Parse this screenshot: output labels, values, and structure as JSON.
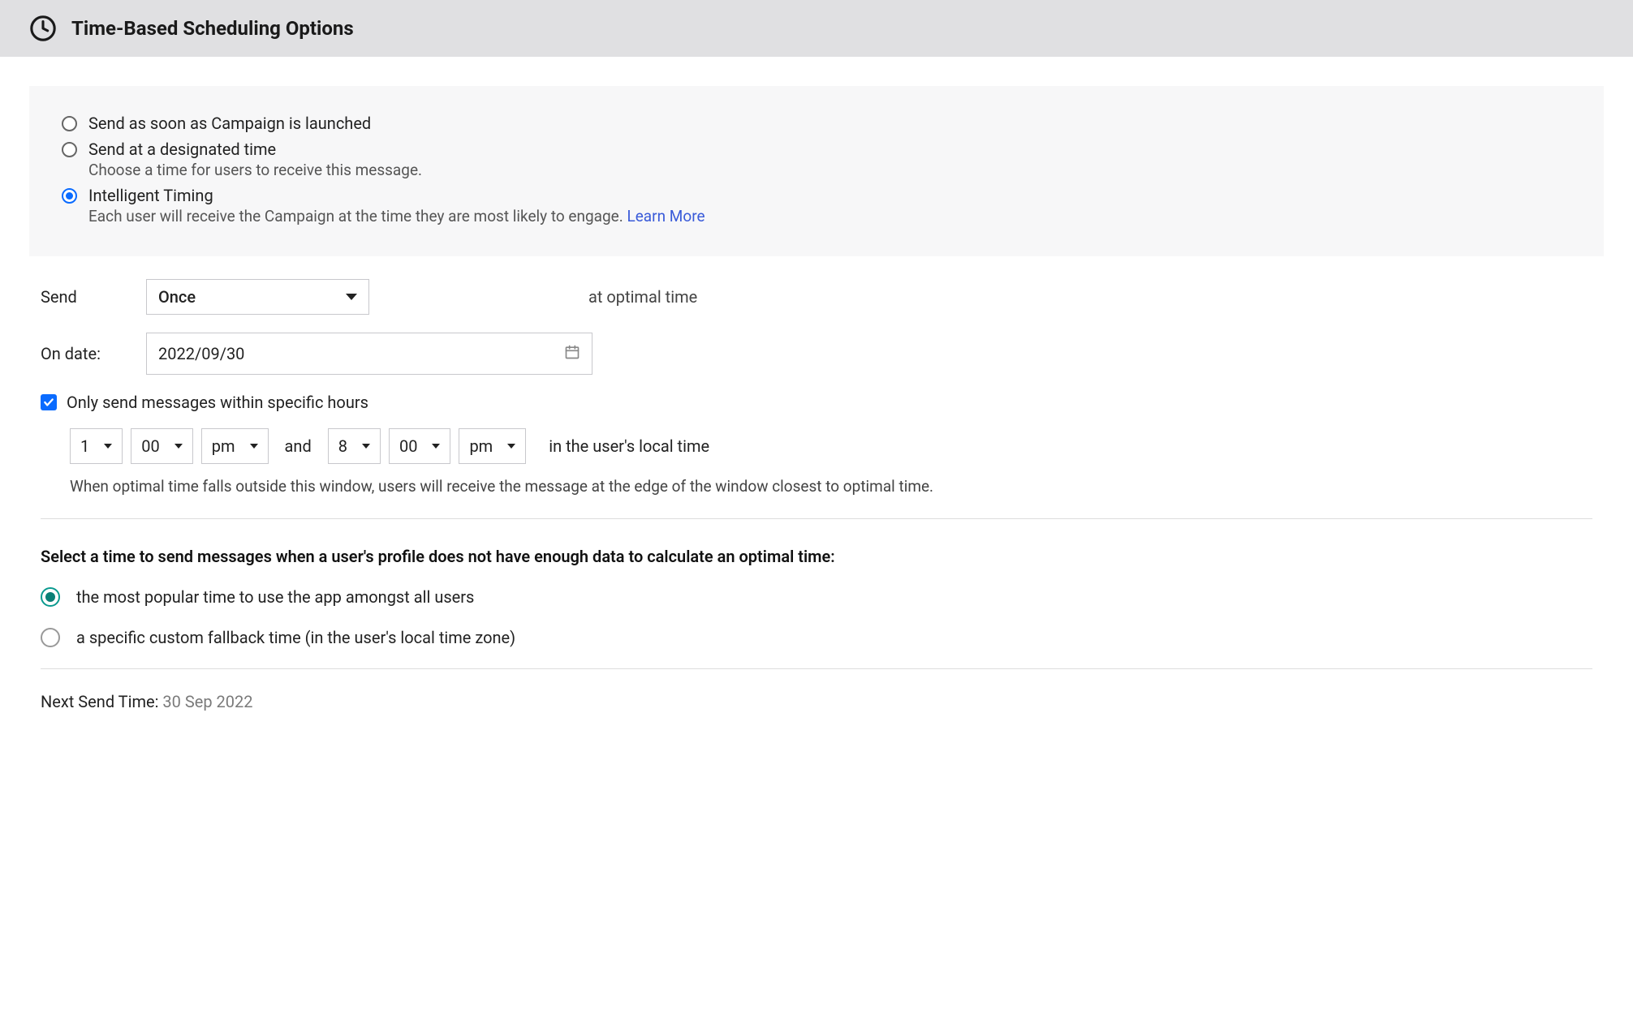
{
  "header": {
    "title": "Time-Based Scheduling Options"
  },
  "timing_options": {
    "immediate": {
      "label": "Send as soon as Campaign is launched"
    },
    "designated": {
      "label": "Send at a designated time",
      "sub": "Choose a time for users to receive this message."
    },
    "intelligent": {
      "label": "Intelligent Timing",
      "sub": "Each user will receive the Campaign at the time they are most likely to engage. ",
      "learn_more": "Learn More"
    }
  },
  "send": {
    "label": "Send",
    "frequency": "Once",
    "suffix": "at optimal time"
  },
  "on_date": {
    "label": "On date:",
    "value": "2022/09/30"
  },
  "specific_hours": {
    "checkbox_label": "Only send messages within specific hours",
    "from_hour": "1",
    "from_min": "00",
    "from_ampm": "pm",
    "connector": "and",
    "to_hour": "8",
    "to_min": "00",
    "to_ampm": "pm",
    "after_text": "in the user's local time",
    "note": "When optimal time falls outside this window, users will receive the message at the edge of the window closest to optimal time."
  },
  "fallback": {
    "heading": "Select a time to send messages when a user's profile does not have enough data to calculate an optimal time:",
    "popular": "the most popular time to use the app amongst all users",
    "custom": "a specific custom fallback time (in the user's local time zone)"
  },
  "next_send": {
    "label": "Next Send Time: ",
    "value": "30 Sep 2022"
  }
}
